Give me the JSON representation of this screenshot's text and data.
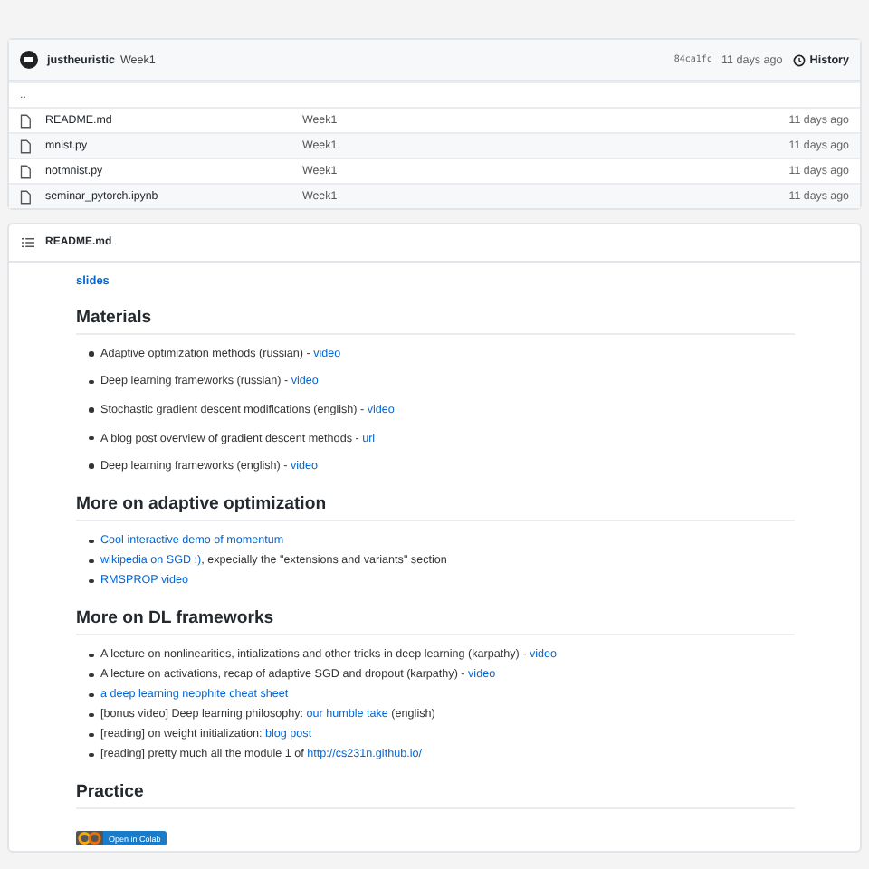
{
  "commit": {
    "author": "justheuristic",
    "message": "Week1",
    "hash": "84ca1fc",
    "time": "11 days ago",
    "history": "History"
  },
  "files": [
    {
      "name": "..",
      "kind": "parent"
    },
    {
      "name": "README.md",
      "kind": "file",
      "message": "Week1",
      "time": "11 days ago"
    },
    {
      "name": "mnist.py",
      "kind": "file",
      "message": "Week1",
      "time": "11 days ago"
    },
    {
      "name": "notmnist.py",
      "kind": "file",
      "message": "Week1",
      "time": "11 days ago"
    },
    {
      "name": "seminar_pytorch.ipynb",
      "kind": "file",
      "message": "Week1",
      "time": "11 days ago"
    }
  ],
  "readme": {
    "title": "README.md",
    "top_link": "slides",
    "sections": [
      {
        "heading": "Materials",
        "kind": "loose",
        "items": [
          [
            {
              "text": "Adaptive optimization methods (russian) - ",
              "link": false
            },
            {
              "text": "video",
              "link": true
            }
          ],
          [
            {
              "text": "Deep learning frameworks (russian) - ",
              "link": false
            },
            {
              "text": "video",
              "link": true
            }
          ],
          [
            {
              "text": "Stochastic gradient descent modifications (english) - ",
              "link": false
            },
            {
              "text": "video",
              "link": true
            }
          ],
          [
            {
              "text": "A blog post overview of gradient descent methods - ",
              "link": false
            },
            {
              "text": "url",
              "link": true
            }
          ],
          [
            {
              "text": "Deep learning frameworks (english) - ",
              "link": false
            },
            {
              "text": "video",
              "link": true
            }
          ]
        ]
      },
      {
        "heading": "More on adaptive optimization",
        "kind": "tight",
        "items": [
          [
            {
              "text": "Cool interactive demo of momentum",
              "link": true
            }
          ],
          [
            {
              "text": "wikipedia on SGD :)",
              "link": true
            },
            {
              "text": ", expecially the \"extensions and variants\" section",
              "link": false
            }
          ],
          [
            {
              "text": "RMSPROP video",
              "link": true
            }
          ]
        ]
      },
      {
        "heading": "More on DL frameworks",
        "kind": "tight",
        "items": [
          [
            {
              "text": "A lecture on nonlinearities, intializations and other tricks in deep learning (karpathy) - ",
              "link": false
            },
            {
              "text": "video",
              "link": true
            }
          ],
          [
            {
              "text": "A lecture on activations, recap of adaptive SGD and dropout (karpathy) - ",
              "link": false
            },
            {
              "text": "video",
              "link": true
            }
          ],
          [
            {
              "text": "a deep learning neophite cheat sheet",
              "link": true
            }
          ],
          [
            {
              "text": "[bonus video] Deep learning philosophy: ",
              "link": false
            },
            {
              "text": "our humble take",
              "link": true
            },
            {
              "text": " (english)",
              "link": false
            }
          ],
          [
            {
              "text": "[reading] on weight initialization: ",
              "link": false
            },
            {
              "text": "blog post",
              "link": true
            }
          ],
          [
            {
              "text": "[reading] pretty much all the module 1 of ",
              "link": false
            },
            {
              "text": "http://cs231n.github.io/",
              "link": true
            }
          ]
        ]
      },
      {
        "heading": "Practice",
        "kind": "badge",
        "badge": "Open in Colab"
      }
    ]
  }
}
